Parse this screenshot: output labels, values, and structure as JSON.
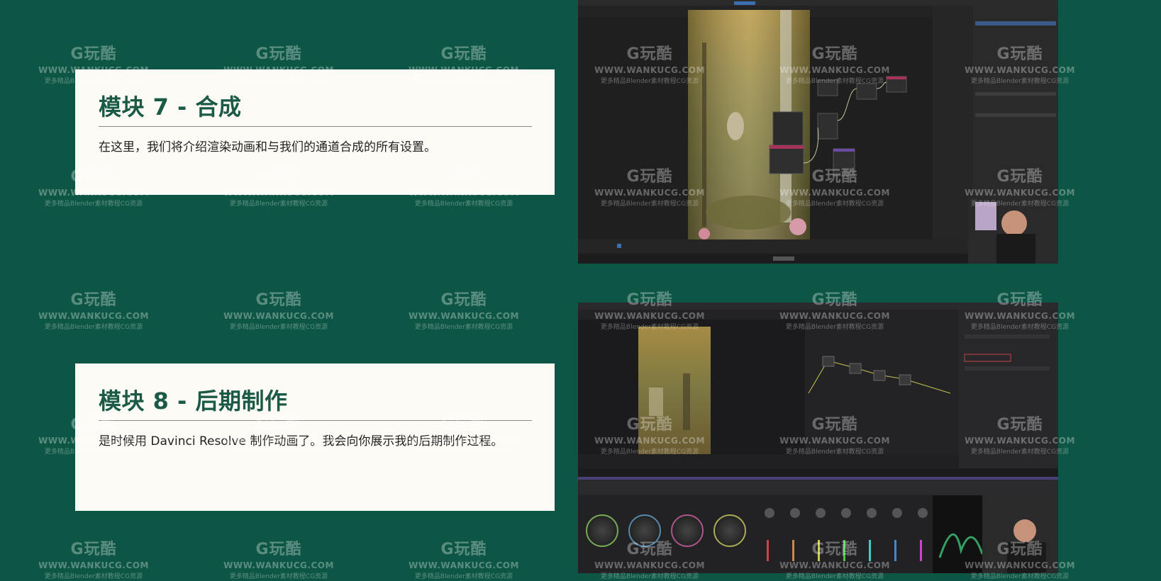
{
  "modules": [
    {
      "title": "模块 7 - 合成",
      "description": "在这里，我们将介绍渲染动画和与我们的通道合成的所有设置。"
    },
    {
      "title": "模块 8 - 后期制作",
      "description": "是时候用 Davinci Resolve 制作动画了。我会向你展示我的后期制作过程。"
    }
  ],
  "watermark": {
    "logo": "G玩酷",
    "url": "WWW.WANKUCG.COM",
    "tagline": "更多精品Blender素材教程CG资源"
  },
  "colors": {
    "background": "#0d5646",
    "card": "#fdfbf6",
    "title": "#1b5a46"
  }
}
